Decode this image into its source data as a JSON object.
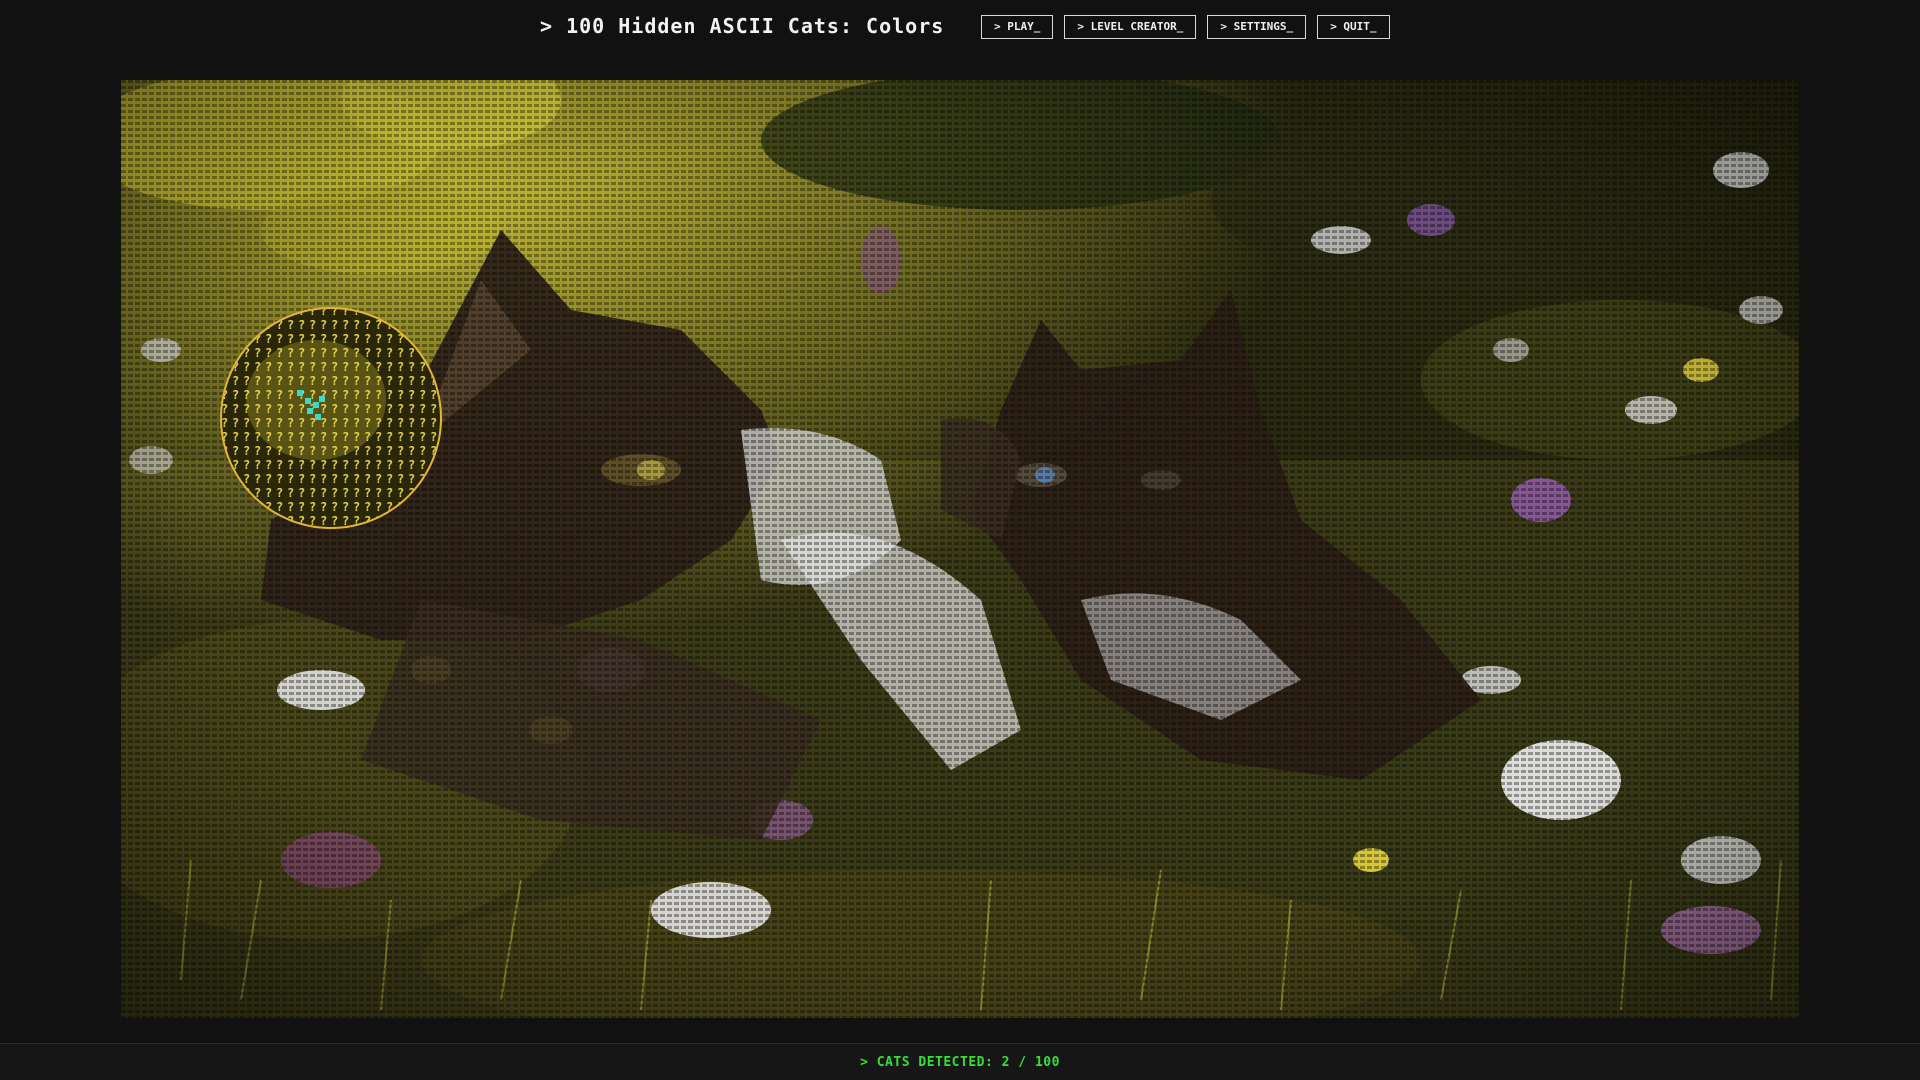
{
  "header": {
    "title": "> 100 Hidden ASCII Cats: Colors"
  },
  "nav": {
    "play_label": "> PLAY_",
    "level_creator_label": "> LEVEL CREATOR_",
    "settings_label": "> SETTINGS_",
    "quit_label": "> QUIT_"
  },
  "scene": {
    "subject": "two tabby cats pawing at each other in a flower meadow",
    "glyph": "?"
  },
  "magnifier": {
    "glyph": "?",
    "ring_color": "#e2b634",
    "found_marker_color": "#3ad9c8"
  },
  "status": {
    "cats_detected_text": "> CATS DETECTED: 2 / 100",
    "found": 2,
    "total": 100
  },
  "colors": {
    "background": "#111111",
    "status_green": "#34e034",
    "meadow_yellow": "#d8d034",
    "flower_white": "#e8e8e8",
    "flower_purple": "#a060c0",
    "cat_brown": "#3a2a1c"
  }
}
